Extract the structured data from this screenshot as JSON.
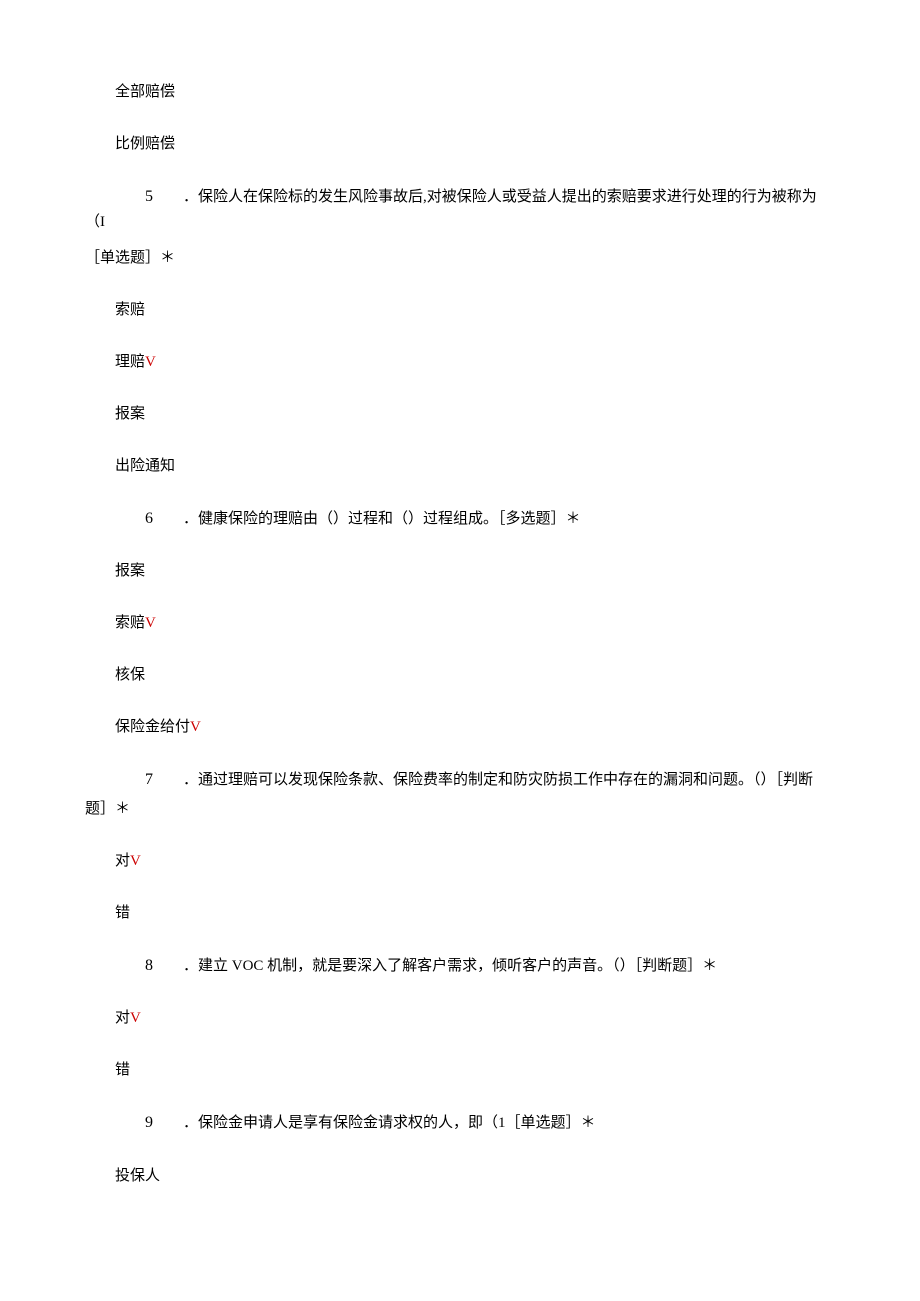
{
  "items": [
    {
      "type": "option",
      "text": "全部赔偿"
    },
    {
      "type": "option",
      "text": "比例赔偿"
    },
    {
      "type": "question",
      "number": "5",
      "text": "．保险人在保险标的发生风险事故后,对被保险人或受益人提出的索赔要求进行处理的行为被称为（I",
      "wrapNext": true
    },
    {
      "type": "wrap",
      "text": "［单选题］＊"
    },
    {
      "type": "option",
      "text": "索赔"
    },
    {
      "type": "option-check",
      "text": "理赔",
      "check": "V"
    },
    {
      "type": "option",
      "text": "报案"
    },
    {
      "type": "option",
      "text": "出险通知"
    },
    {
      "type": "question",
      "number": "6",
      "text": "．健康保险的理赔由（）过程和（）过程组成。［多选题］＊"
    },
    {
      "type": "option",
      "text": "报案"
    },
    {
      "type": "option-check",
      "text": "索赔",
      "check": "V"
    },
    {
      "type": "option",
      "text": "核保"
    },
    {
      "type": "option-check",
      "text": "保险金给付",
      "check": "V"
    },
    {
      "type": "question",
      "number": "7",
      "text": "．通过理赔可以发现保险条款、保险费率的制定和防灾防损工作中存在的漏洞和问题。（）［判断",
      "wrapNext": true
    },
    {
      "type": "wrap-tight",
      "text": "题］＊"
    },
    {
      "type": "option-check",
      "text": "对",
      "check": "V"
    },
    {
      "type": "option",
      "text": "错"
    },
    {
      "type": "question",
      "number": "8",
      "text": "．建立 VOC 机制，就是要深入了解客户需求，倾听客户的声音。（）［判断题］＊",
      "hasVoc": true
    },
    {
      "type": "option-check",
      "text": "对",
      "check": "V"
    },
    {
      "type": "option",
      "text": "错"
    },
    {
      "type": "question",
      "number": "9",
      "text": "．保险金申请人是享有保险金请求权的人，即（1［单选题］＊"
    },
    {
      "type": "option",
      "text": "投保人"
    }
  ]
}
